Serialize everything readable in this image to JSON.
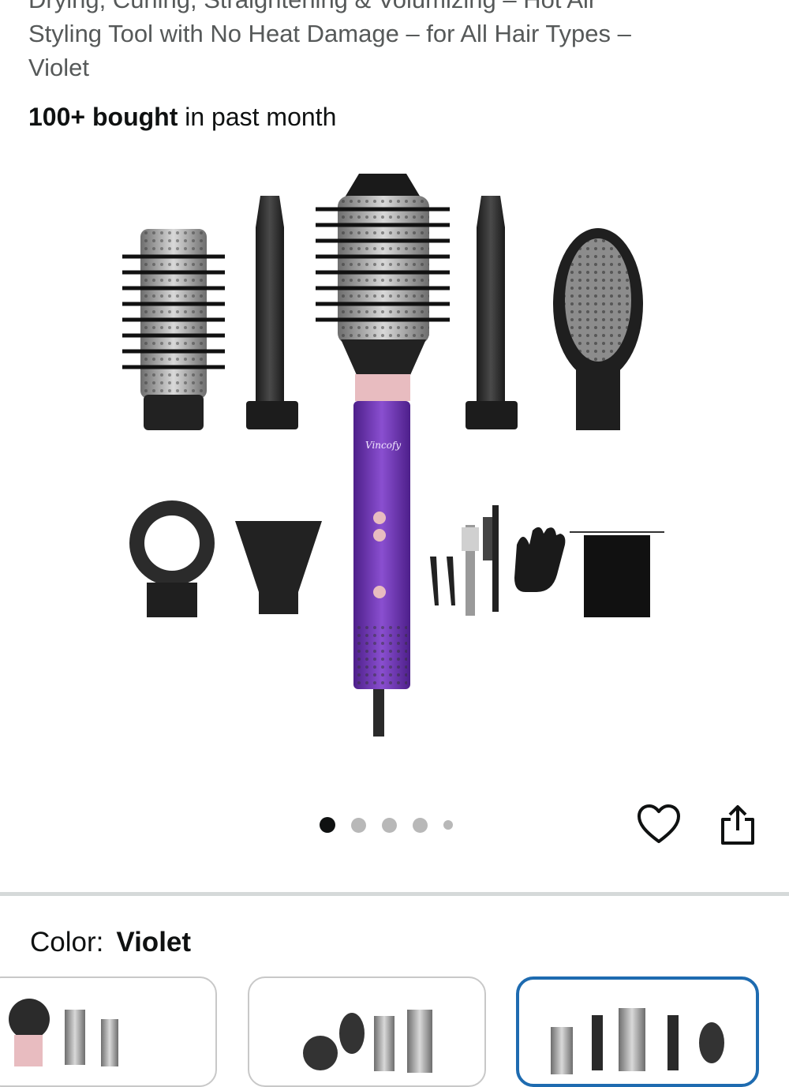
{
  "product": {
    "title_lines": [
      "Drying, Curling, Straightening & Volumizing – Hot Air",
      "Styling Tool with No Heat Damage – for All Hair Types –",
      "Violet"
    ],
    "bought_bold": "100+ bought",
    "bought_rest": " in past month",
    "brand_logo_text": "Vincofy"
  },
  "gallery": {
    "image_count": 5,
    "active_index": 0
  },
  "actions": {
    "heart_icon": "heart-icon",
    "share_icon": "share-icon"
  },
  "variation": {
    "label": "Color:",
    "value": "Violet",
    "swatches_selected_index": 2
  },
  "colors": {
    "violet": "#6a2fb0",
    "selected_border": "#1e6bb0",
    "divider": "#d5d9d9"
  }
}
